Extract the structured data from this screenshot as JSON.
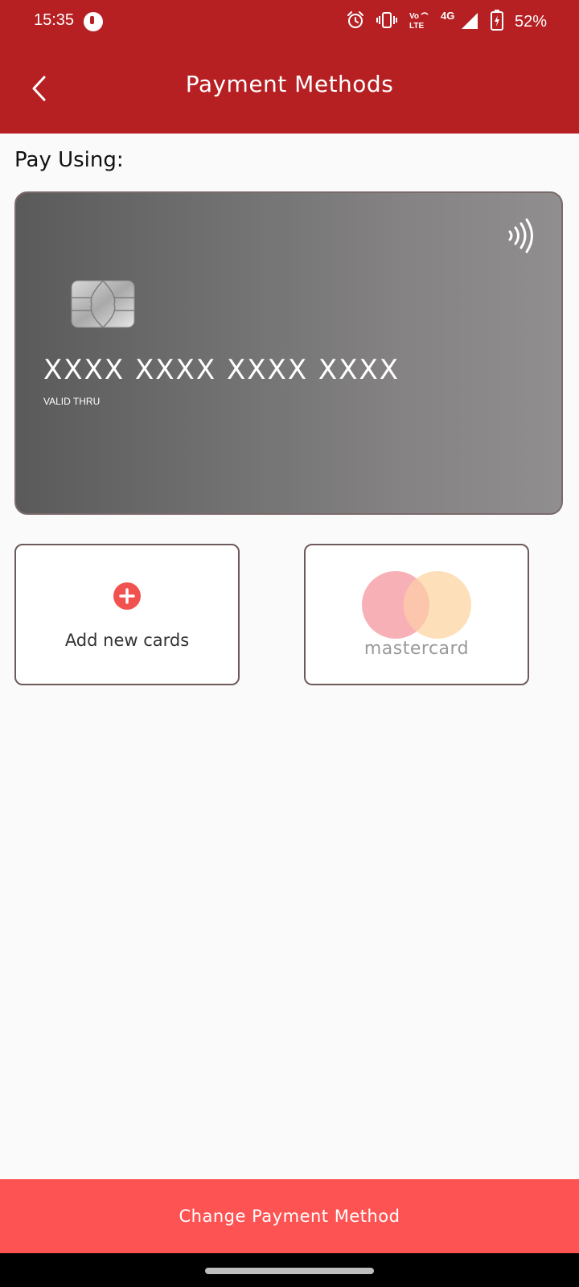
{
  "status_bar": {
    "time": "15:35",
    "battery": "52%",
    "icons": [
      "app-notification-icon",
      "alarm-icon",
      "vibrate-icon",
      "volte-icon",
      "4g-icon",
      "signal-icon",
      "battery-charging-icon"
    ],
    "network_label": "4G",
    "volte_label_top": "Vo",
    "volte_label_bottom": "LTE"
  },
  "header": {
    "title": "Payment Methods",
    "back_icon": "chevron-left-icon"
  },
  "section_label": "Pay Using:",
  "card": {
    "number": "XXXX XXXX XXXX XXXX",
    "valid_thru_label": "VALID THRU",
    "chip_icon": "card-chip-icon",
    "contactless_icon": "contactless-icon"
  },
  "options": {
    "add_card": {
      "label": "Add new cards",
      "icon": "plus-circle-icon"
    },
    "mastercard": {
      "label": "mastercard",
      "icon": "mastercard-logo"
    }
  },
  "cta": {
    "label": "Change Payment Method"
  },
  "colors": {
    "header": "#b72023",
    "accent": "#fd5352",
    "background": "#fbfafb"
  }
}
